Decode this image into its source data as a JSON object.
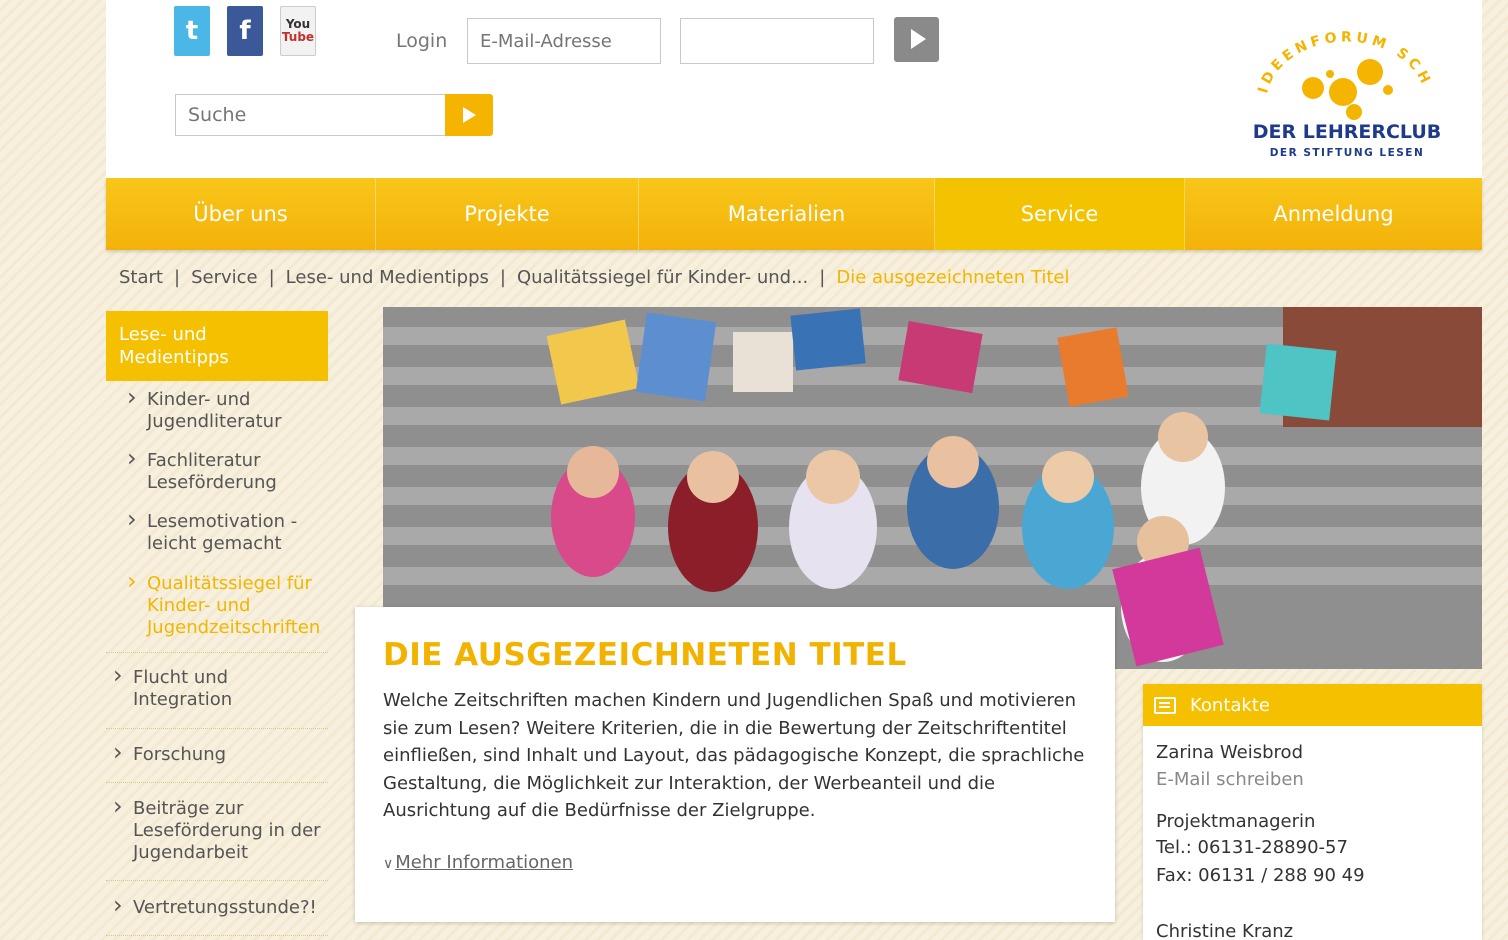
{
  "header": {
    "social": {
      "twitter": "t",
      "facebook": "f",
      "youtube_1": "You",
      "youtube_2": "Tube"
    },
    "login_label": "Login",
    "email_placeholder": "E-Mail-Adresse",
    "password_value": "",
    "search_placeholder": "Suche",
    "logo": {
      "arc_text": "IDEENFORUM SCHULE",
      "title": "DER LEHRERCLUB",
      "subtitle": "DER STIFTUNG LESEN",
      "brand_color": "#1e3a8a",
      "accent": "#f5b400"
    }
  },
  "nav": {
    "items": [
      "Über uns",
      "Projekte",
      "Materialien",
      "Service",
      "Anmeldung"
    ],
    "active": "Service"
  },
  "breadcrumb": [
    "Start",
    "Service",
    "Lese- und Medientipps",
    "Qualitätssiegel für Kinder- und...",
    "Die ausgezeichneten Titel"
  ],
  "sidebar": {
    "heading": "Lese- und Medientipps",
    "subitems": [
      "Kinder- und Jugendliteratur",
      "Fachliteratur Leseförderung",
      "Lesemotivation - leicht gemacht",
      "Qualitätssiegel für Kinder- und Jugendzeitschriften"
    ],
    "items": [
      "Flucht und Integration",
      "Forschung",
      "Beiträge zur Leseförderung in der Jugendarbeit",
      "Vertretungsstunde?!"
    ]
  },
  "main": {
    "title": "DIE AUSGEZEICHNETEN TITEL",
    "text": "Welche Zeitschriften machen Kindern und Jugendlichen Spaß und motivieren sie zum Lesen? Weitere Kriterien, die in die Bewertung der Zeitschriftentitel einfließen, sind Inhalt und Layout, das pädagogische Konzept, die sprachliche Gestaltung, die Möglichkeit zur Interaktion, der Werbeanteil und die Ausrichtung auf die Bedürfnisse der Zielgruppe.",
    "more_link": "Mehr Informationen"
  },
  "contacts": {
    "heading": "Kontakte",
    "name": "Zarina Weisbrod",
    "email_link": "E-Mail schreiben",
    "role": "Projektmanagerin",
    "tel": "Tel.: 06131-28890-57",
    "fax": "Fax: 06131 / 288 90 49",
    "name2": "Christine Kranz"
  },
  "colors": {
    "accent": "#f5c000",
    "accent_text": "#f2b600"
  }
}
